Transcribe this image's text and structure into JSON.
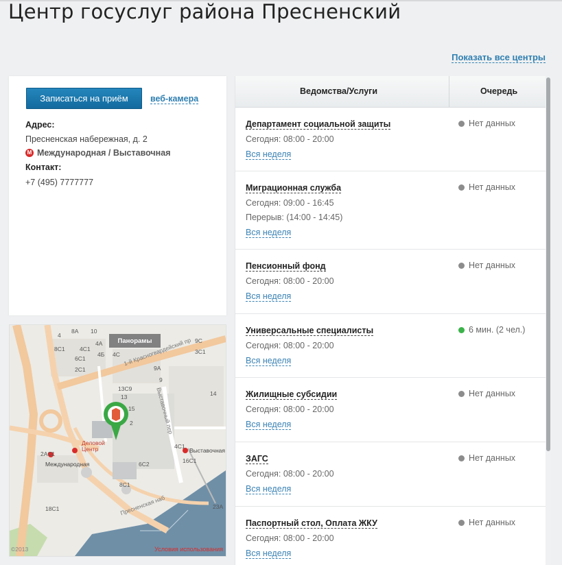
{
  "page": {
    "title": "Центр госуслуг района Пресненский",
    "show_all_link": "Показать все центры"
  },
  "info": {
    "book_button": "Записаться на приём",
    "webcam_link": "веб-камера",
    "address_label": "Адрес:",
    "address": "Пресненская набережная, д. 2",
    "metro_icon": "М",
    "metro": "Международная / Выставочная",
    "contact_label": "Контакт:",
    "phone": "+7 (495) 7777777"
  },
  "map": {
    "panoramas_button": "Панорамы",
    "terms_link": "Условия использования",
    "copyright": "©2013",
    "place_labels": {
      "business_center": "Деловой Центр",
      "metro_mezhdunarodnaya": "Международная",
      "metro_vystavochnaya": "Выставочная",
      "street_krasnogvardeysky": "1-й Красногвардейский пр",
      "street_vystavochny": "Выставочный пер",
      "street_presnenskaya": "Пресненская наб"
    },
    "building_labels": [
      "8А",
      "10",
      "9С",
      "8С1",
      "4С1",
      "4С",
      "3С1",
      "4Б",
      "6С1",
      "4А",
      "4",
      "2С1",
      "9А",
      "9",
      "13С9",
      "13",
      "15",
      "14",
      "2",
      "4С1",
      "16С1",
      "2АС1",
      "6С2",
      "8С1",
      "18С1",
      "23А"
    ]
  },
  "services": {
    "columns": {
      "service": "Ведомства/Услуги",
      "queue": "Очередь"
    },
    "items": [
      {
        "name": "Департамент социальной защиты",
        "hours": "Сегодня: 08:00 - 20:00",
        "break": "",
        "week_link": "Вся неделя",
        "queue": "Нет данных",
        "status_color": "#8c8c8c"
      },
      {
        "name": "Миграционная служба",
        "hours": "Сегодня: 09:00 - 16:45",
        "break": "Перерыв: (14:00 - 14:45)",
        "week_link": "Вся неделя",
        "queue": "Нет данных",
        "status_color": "#8c8c8c"
      },
      {
        "name": "Пенсионный фонд",
        "hours": "Сегодня: 08:00 - 20:00",
        "break": "",
        "week_link": "Вся неделя",
        "queue": "Нет данных",
        "status_color": "#8c8c8c"
      },
      {
        "name": "Универсальные специалисты",
        "hours": "Сегодня: 08:00 - 20:00",
        "break": "",
        "week_link": "Вся неделя",
        "queue": "6 мин. (2 чел.)",
        "status_color": "#3bb34a"
      },
      {
        "name": "Жилищные субсидии",
        "hours": "Сегодня: 08:00 - 20:00",
        "break": "",
        "week_link": "Вся неделя",
        "queue": "Нет данных",
        "status_color": "#8c8c8c"
      },
      {
        "name": "ЗАГС",
        "hours": "Сегодня: 08:00 - 20:00",
        "break": "",
        "week_link": "Вся неделя",
        "queue": "Нет данных",
        "status_color": "#8c8c8c"
      },
      {
        "name": "Паспортный стол, Оплата ЖКУ",
        "hours": "Сегодня: 08:00 - 20:00",
        "break": "",
        "week_link": "Вся неделя",
        "queue": "Нет данных",
        "status_color": "#8c8c8c"
      }
    ]
  },
  "colors": {
    "accent_blue": "#2f7fb1",
    "button_blue": "#1a78b0",
    "metro_red": "#d92b2b",
    "pin_green": "#3aa845",
    "river": "#6f8fa7"
  }
}
